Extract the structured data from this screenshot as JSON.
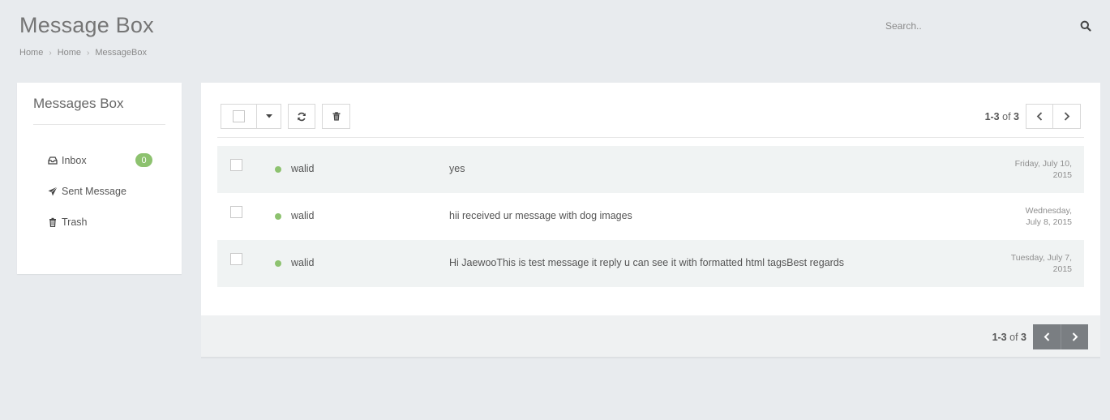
{
  "header": {
    "title": "Message Box",
    "breadcrumb": [
      "Home",
      "Home",
      "MessageBox"
    ]
  },
  "search": {
    "placeholder": "Search.."
  },
  "sidebar": {
    "title": "Messages Box",
    "items": [
      {
        "label": "Inbox",
        "icon": "inbox-icon",
        "badge": "0"
      },
      {
        "label": "Sent Message",
        "icon": "paper-plane-icon"
      },
      {
        "label": "Trash",
        "icon": "trash-icon"
      }
    ]
  },
  "pagination": {
    "range": "1-3",
    "of": "of",
    "total": "3"
  },
  "messages": [
    {
      "sender": "walid",
      "subject": "yes",
      "date_line1": "Friday, July 10,",
      "date_line2": "2015",
      "unread": true
    },
    {
      "sender": "walid",
      "subject": "hii received ur message with dog images",
      "date_line1": "Wednesday,",
      "date_line2": "July 8, 2015",
      "unread": true
    },
    {
      "sender": "walid",
      "subject": "Hi JaewooThis is test message it reply u can see it with formatted html tagsBest regards",
      "date_line1": "Tuesday, July 7,",
      "date_line2": "2015",
      "unread": true
    }
  ],
  "colors": {
    "accent_green": "#8dc26f",
    "background": "#e8ebee",
    "pager_dark": "#7a7e82"
  }
}
